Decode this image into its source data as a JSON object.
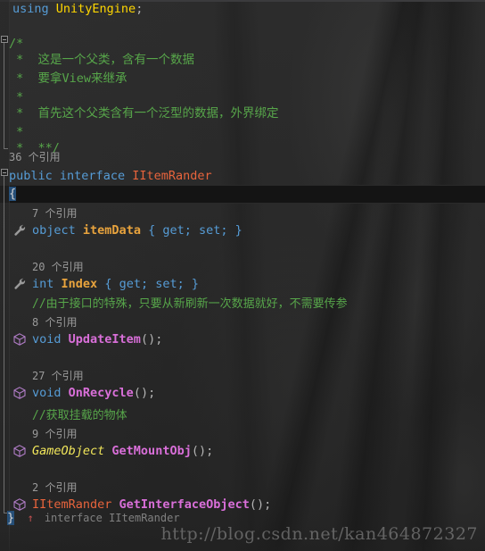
{
  "app": {
    "kind": "visual-studio-code-editor",
    "theme": "dark",
    "language": "csharp"
  },
  "colors": {
    "background": "#252526",
    "keyword": "#569cd6",
    "type_yellow": "#ffd700",
    "type_orange": "#e8643c",
    "identifier": "#e8a33d",
    "method": "#d96fd9",
    "comment": "#57a64a",
    "reference_count": "#9a9a9a",
    "selection": "#264f78",
    "current_line": "#141414",
    "watermark": "#bebebe"
  },
  "code": {
    "line01": {
      "kw": "using",
      "type": "UnityEngine",
      "semi": ";"
    },
    "line03": {
      "text": "/*"
    },
    "line04": {
      "text": " *  这是一个父类，含有一个数据"
    },
    "line05": {
      "text": " *  要拿View来继承"
    },
    "line06": {
      "text": " * "
    },
    "line07": {
      "text": " *  首先这个父类含有一个泛型的数据，外界绑定"
    },
    "line08": {
      "text": " * "
    },
    "line09": {
      "text": " *  **/"
    },
    "ref_interface": "36 个引用",
    "line10": {
      "kw1": "public",
      "kw2": "interface",
      "name": "IItemRander"
    },
    "line11": {
      "brace": "{"
    },
    "ref_itemdata": "7 个引用",
    "line12": {
      "kw": "object",
      "name": "itemData",
      "accessors": "{ get; set; }"
    },
    "ref_index": "20 个引用",
    "line13": {
      "kw": "int",
      "name": "Index",
      "accessors": "{ get; set; }"
    },
    "comment_update": "//由于接口的特殊，只要从新刷新一次数据就好，不需要传参",
    "ref_updateitem": "8 个引用",
    "line14": {
      "kw": "void",
      "name": "UpdateItem",
      "tail": "();"
    },
    "ref_onrecycle": "27 个引用",
    "line15": {
      "kw": "void",
      "name": "OnRecycle",
      "tail": "();"
    },
    "comment_mount": "//获取挂载的物体",
    "ref_getmountobj": "9 个引用",
    "line16": {
      "type": "GameObject",
      "name": "GetMountObj",
      "tail": "();"
    },
    "ref_getinterfaceobject": "2 个引用",
    "line17": {
      "type": "IItemRander",
      "name": "GetInterfaceObject",
      "tail": "();"
    },
    "line18": {
      "brace": "}"
    }
  },
  "hint": {
    "arrow": "↑",
    "text": "interface IItemRander"
  },
  "watermark": {
    "text": "http://blog.csdn.net/kan464872327"
  },
  "icons": {
    "property": "wrench-icon",
    "method": "cube-icon",
    "fold": "fold-box-icon",
    "structure_up": "up-arrow-icon"
  }
}
